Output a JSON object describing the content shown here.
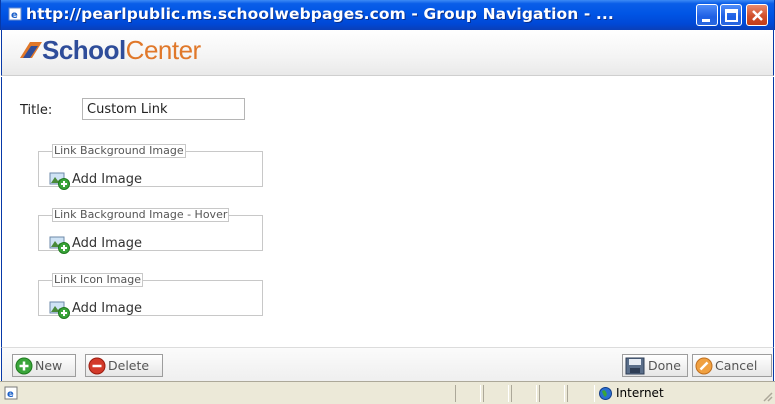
{
  "window": {
    "title": "http://pearlpublic.ms.schoolwebpages.com - Group Navigation - ...",
    "controls": [
      "minimize-icon",
      "maximize-icon",
      "close-icon"
    ]
  },
  "header": {
    "logo_part1": "School",
    "logo_part2": "Center",
    "colors": {
      "school": "#2f4d9a",
      "center": "#e0782a"
    }
  },
  "form": {
    "title_label": "Title:",
    "title_value": "Custom Link",
    "image_groups": [
      {
        "legend": "Link Background Image",
        "action": "Add Image"
      },
      {
        "legend": "Link Background Image - Hover",
        "action": "Add Image"
      },
      {
        "legend": "Link Icon Image",
        "action": "Add Image"
      }
    ]
  },
  "toolbar": {
    "new_label": "New",
    "delete_label": "Delete",
    "done_label": "Done",
    "cancel_label": "Cancel"
  },
  "statusbar": {
    "zone_label": "Internet"
  }
}
